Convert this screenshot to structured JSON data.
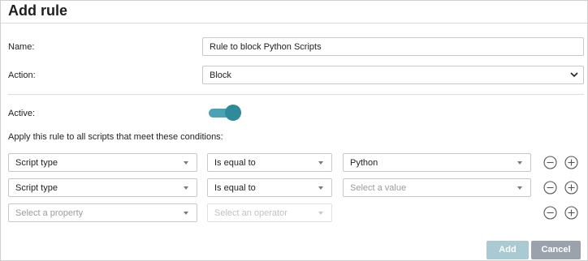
{
  "dialog": {
    "title": "Add rule"
  },
  "form": {
    "name_label": "Name:",
    "name_value": "Rule to block Python Scripts",
    "action_label": "Action:",
    "action_value": "Block",
    "active_label": "Active:",
    "active_state": true,
    "conditions_intro": "Apply this rule to all scripts that meet these conditions:"
  },
  "conditions": [
    {
      "property": "Script type",
      "operator": "Is equal to",
      "value": "Python",
      "value_is_placeholder": false
    },
    {
      "property": "Script type",
      "operator": "Is equal to",
      "value": "Select a value",
      "value_is_placeholder": true
    },
    {
      "property": "Select a property",
      "operator": "Select an operator",
      "property_is_placeholder": true,
      "operator_disabled": true
    }
  ],
  "footer": {
    "add_label": "Add",
    "cancel_label": "Cancel"
  },
  "colors": {
    "toggle_accent": "#2f8a9c",
    "add_button": "#a9c9d3",
    "cancel_button": "#9aa3ab"
  }
}
